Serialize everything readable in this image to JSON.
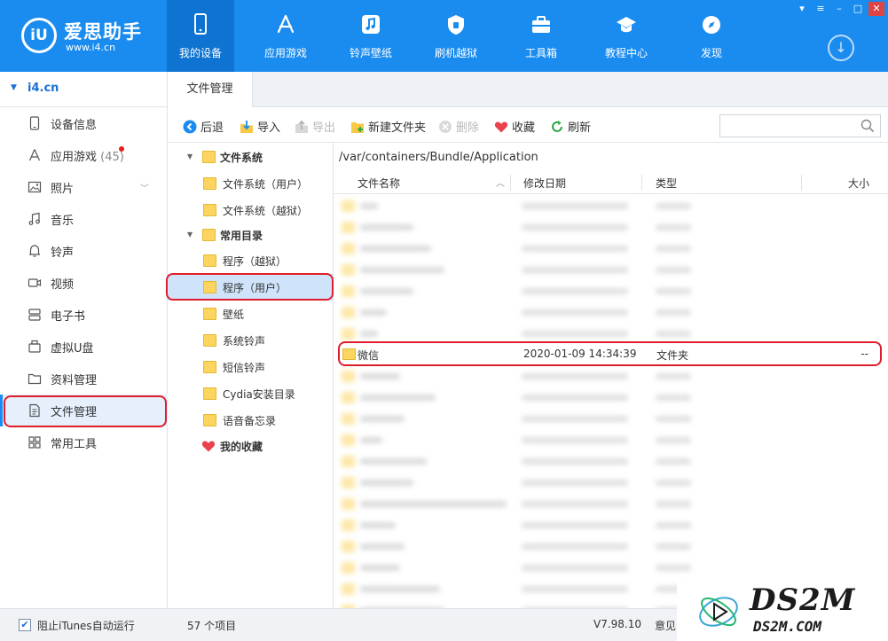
{
  "header": {
    "logo_mark": "iU",
    "app_name": "爱思助手",
    "app_url": "www.i4.cn",
    "nav": [
      {
        "label": "我的设备",
        "icon": "phone-icon",
        "active": true
      },
      {
        "label": "应用游戏",
        "icon": "app-store-icon",
        "active": false
      },
      {
        "label": "铃声壁纸",
        "icon": "music-note-icon",
        "active": false
      },
      {
        "label": "刷机越狱",
        "icon": "shield-icon",
        "active": false
      },
      {
        "label": "工具箱",
        "icon": "toolbox-icon",
        "active": false
      },
      {
        "label": "教程中心",
        "icon": "graduation-cap-icon",
        "active": false
      },
      {
        "label": "发现",
        "icon": "compass-icon",
        "active": false
      }
    ],
    "download_glyph": "↓"
  },
  "sidebar": {
    "device_name": "i4.cn",
    "items": [
      {
        "label": "设备信息",
        "icon": "device-info-icon"
      },
      {
        "label": "应用游戏",
        "icon": "app-store-icon",
        "count": "(45)",
        "has_dot": true
      },
      {
        "label": "照片",
        "icon": "photo-icon",
        "expandable": true
      },
      {
        "label": "音乐",
        "icon": "music-icon"
      },
      {
        "label": "铃声",
        "icon": "bell-icon"
      },
      {
        "label": "视频",
        "icon": "video-icon"
      },
      {
        "label": "电子书",
        "icon": "ebook-icon"
      },
      {
        "label": "虚拟U盘",
        "icon": "usb-drive-icon"
      },
      {
        "label": "资料管理",
        "icon": "folder-icon"
      },
      {
        "label": "文件管理",
        "icon": "file-icon",
        "selected": true
      },
      {
        "label": "常用工具",
        "icon": "grid-icon"
      }
    ]
  },
  "tabs": [
    {
      "label": "文件管理",
      "active": true
    }
  ],
  "toolbar": {
    "back": "后退",
    "import": "导入",
    "export": "导出",
    "new_folder": "新建文件夹",
    "delete": "删除",
    "favorite": "收藏",
    "refresh": "刷新",
    "search_placeholder": ""
  },
  "tree": [
    {
      "label": "文件系统",
      "level": 0,
      "expanded": true,
      "bold": true
    },
    {
      "label": "文件系统（用户）",
      "level": 1
    },
    {
      "label": "文件系统（越狱）",
      "level": 1
    },
    {
      "label": "常用目录",
      "level": 0,
      "expanded": true,
      "bold": true
    },
    {
      "label": "程序（越狱）",
      "level": 1
    },
    {
      "label": "程序（用户）",
      "level": 1,
      "selected": true
    },
    {
      "label": "壁纸",
      "level": 1
    },
    {
      "label": "系统铃声",
      "level": 1
    },
    {
      "label": "短信铃声",
      "level": 1
    },
    {
      "label": "Cydia安装目录",
      "level": 1
    },
    {
      "label": "语音备忘录",
      "level": 1
    },
    {
      "label": "我的收藏",
      "level": 0,
      "bold": true,
      "icon": "heart-icon"
    }
  ],
  "path": "/var/containers/Bundle/Application",
  "columns": {
    "name": "文件名称",
    "date": "修改日期",
    "type": "类型",
    "size": "大小"
  },
  "visible_file": {
    "name": "微信",
    "date": "2020-01-09 14:34:39",
    "type": "文件夹",
    "size": "--"
  },
  "status": {
    "itunes_checkbox_label": "阻止iTunes自动运行",
    "itunes_checked": true,
    "item_count": "57 个项目",
    "version": "V7.98.10",
    "feedback": "意见"
  },
  "watermark": {
    "big": "DS2M",
    "small": "DS2M.COM"
  },
  "colors": {
    "header_blue": "#1a8cf0",
    "nav_active": "#0f74d1",
    "highlight_red": "#e01e2b",
    "folder_yellow": "#fbd560"
  }
}
